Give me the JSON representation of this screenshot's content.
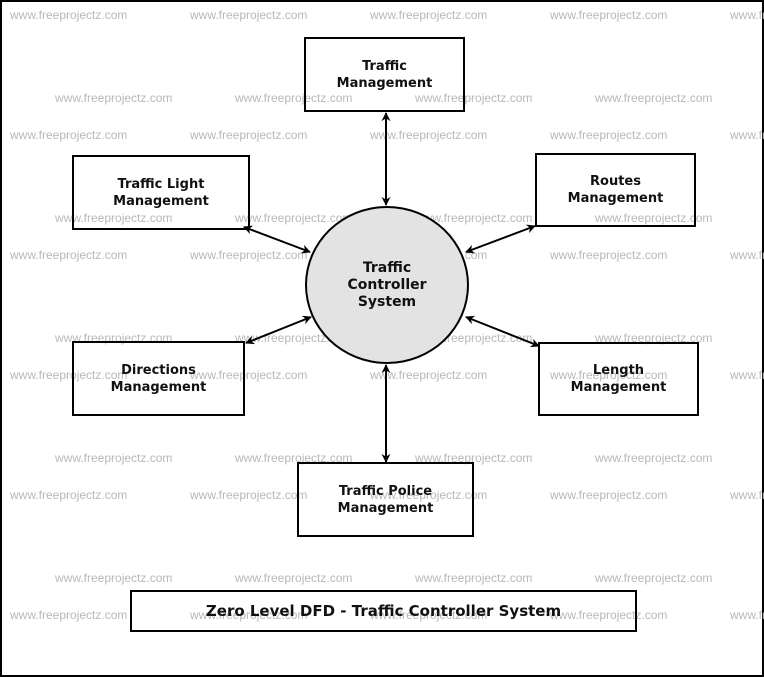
{
  "diagram": {
    "type": "Zero Level DFD",
    "title": "Zero Level DFD - Traffic Controller System",
    "watermark": "www.freeprojectz.com",
    "process": {
      "id": "traffic-controller-system",
      "label": "Traffic\nController\nSystem",
      "fill": "#e3e3e3"
    },
    "entities": [
      {
        "id": "traffic-management",
        "label": "Traffic\nManagement"
      },
      {
        "id": "traffic-light-management",
        "label": "Traffic Light\nManagement"
      },
      {
        "id": "routes-management",
        "label": "Routes\nManagement"
      },
      {
        "id": "directions-management",
        "label": "Directions\nManagement"
      },
      {
        "id": "length-management",
        "label": "Length\nManagement"
      },
      {
        "id": "traffic-police-management",
        "label": "Traffic Police\nManagement"
      }
    ],
    "flows": [
      {
        "from": "traffic-management",
        "to": "traffic-controller-system",
        "bidirectional": true
      },
      {
        "from": "traffic-light-management",
        "to": "traffic-controller-system",
        "bidirectional": true
      },
      {
        "from": "routes-management",
        "to": "traffic-controller-system",
        "bidirectional": true
      },
      {
        "from": "directions-management",
        "to": "traffic-controller-system",
        "bidirectional": true
      },
      {
        "from": "length-management",
        "to": "traffic-controller-system",
        "bidirectional": true
      },
      {
        "from": "traffic-police-management",
        "to": "traffic-controller-system",
        "bidirectional": true
      }
    ]
  }
}
